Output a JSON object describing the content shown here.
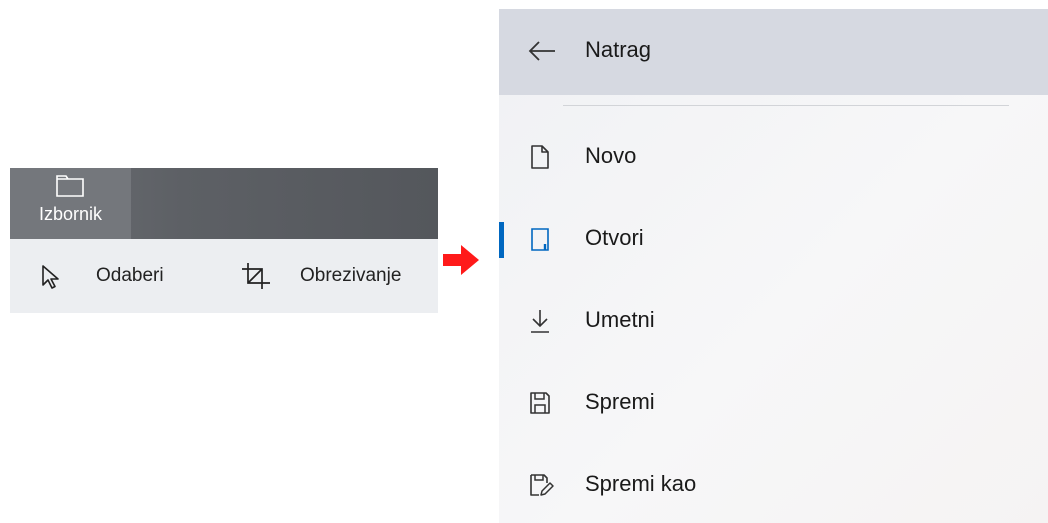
{
  "toolbar": {
    "menu_tab": {
      "icon": "folder-icon",
      "label": "Izbornik"
    },
    "tools": [
      {
        "icon": "cursor-arrow-icon",
        "label": "Odaberi"
      },
      {
        "icon": "crop-icon",
        "label": "Obrezivanje"
      }
    ]
  },
  "transition_arrow": {
    "icon": "right-arrow-icon",
    "color": "#ff1a1a"
  },
  "file_menu": {
    "back": {
      "icon": "back-arrow-icon",
      "label": "Natrag"
    },
    "items": [
      {
        "icon": "new-document-icon",
        "label": "Novo",
        "selected": false
      },
      {
        "icon": "open-file-icon",
        "label": "Otvori",
        "selected": true
      },
      {
        "icon": "download-insert-icon",
        "label": "Umetni",
        "selected": false
      },
      {
        "icon": "save-icon",
        "label": "Spremi",
        "selected": false
      },
      {
        "icon": "save-as-icon",
        "label": "Spremi kao",
        "selected": false
      }
    ],
    "accent_color": "#0067c0"
  }
}
